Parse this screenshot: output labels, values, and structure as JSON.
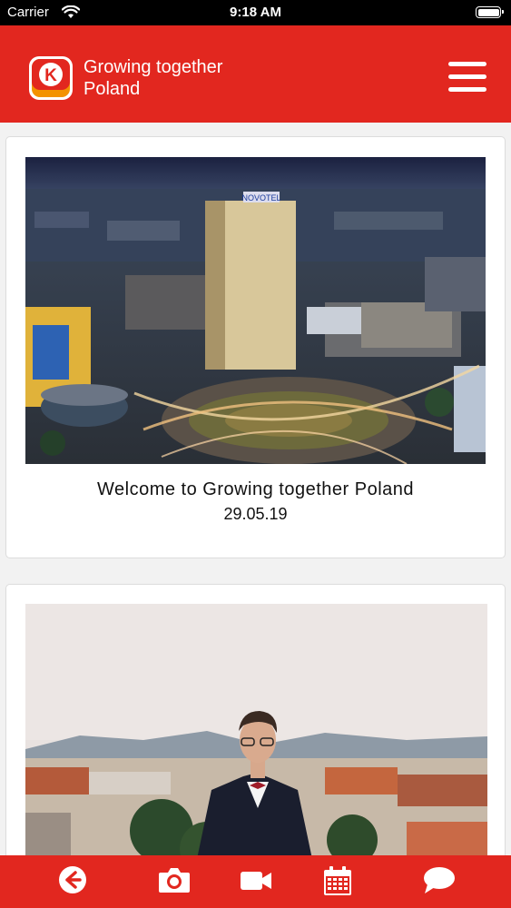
{
  "status_bar": {
    "carrier": "Carrier",
    "time": "9:18 AM"
  },
  "header": {
    "title_line1": "Growing together",
    "title_line2": "Poland",
    "logo_letter": "K"
  },
  "feed": {
    "posts": [
      {
        "title": "Welcome to Growing together Poland",
        "date": "29.05.19"
      },
      {
        "title": "",
        "date": ""
      }
    ]
  },
  "tab_bar": {
    "items": [
      {
        "icon": "back-arrow-icon"
      },
      {
        "icon": "camera-icon"
      },
      {
        "icon": "video-icon"
      },
      {
        "icon": "calendar-icon"
      },
      {
        "icon": "chat-bubble-icon"
      }
    ]
  },
  "colors": {
    "brand_red": "#e2271f",
    "logo_orange": "#f39200"
  }
}
